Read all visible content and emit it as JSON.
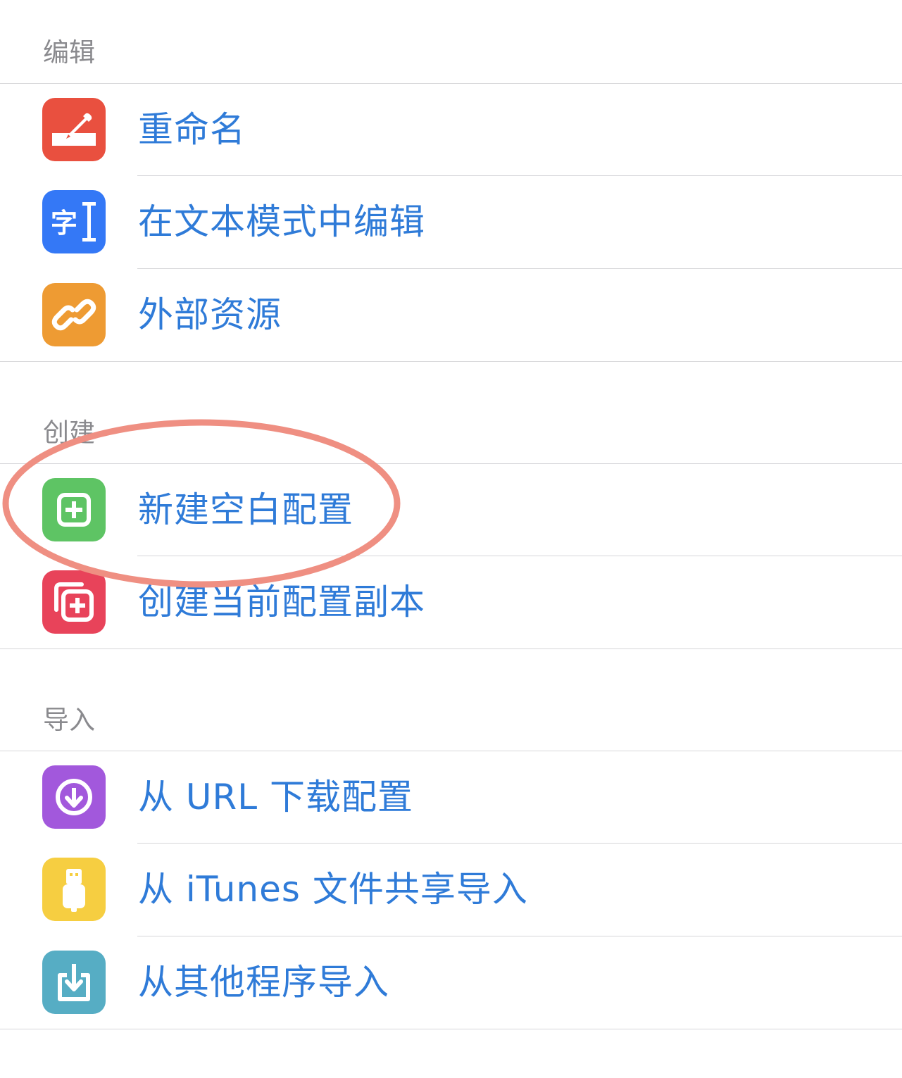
{
  "sections": [
    {
      "header": "编辑",
      "items": [
        {
          "label": "重命名",
          "icon": "rename-icon",
          "color": "#e9503f"
        },
        {
          "label": "在文本模式中编辑",
          "icon": "text-edit-icon",
          "color": "#3478f6"
        },
        {
          "label": "外部资源",
          "icon": "link-icon",
          "color": "#ee9b33"
        }
      ]
    },
    {
      "header": "创建",
      "items": [
        {
          "label": "新建空白配置",
          "icon": "plus-square-icon",
          "color": "#5ec464"
        },
        {
          "label": "创建当前配置副本",
          "icon": "duplicate-icon",
          "color": "#e8435a"
        }
      ]
    },
    {
      "header": "导入",
      "items": [
        {
          "label": "从 URL 下载配置",
          "icon": "download-circle-icon",
          "color": "#a258dc"
        },
        {
          "label": "从 iTunes 文件共享导入",
          "icon": "usb-icon",
          "color": "#f6ce41"
        },
        {
          "label": "从其他程序导入",
          "icon": "import-icon",
          "color": "#56adc4"
        }
      ]
    }
  ],
  "colors": {
    "label_text": "#2f7bd8",
    "header_text": "#8a8a8e",
    "separator": "#d6d6d9",
    "highlight_annotation": "#ef8f82"
  }
}
